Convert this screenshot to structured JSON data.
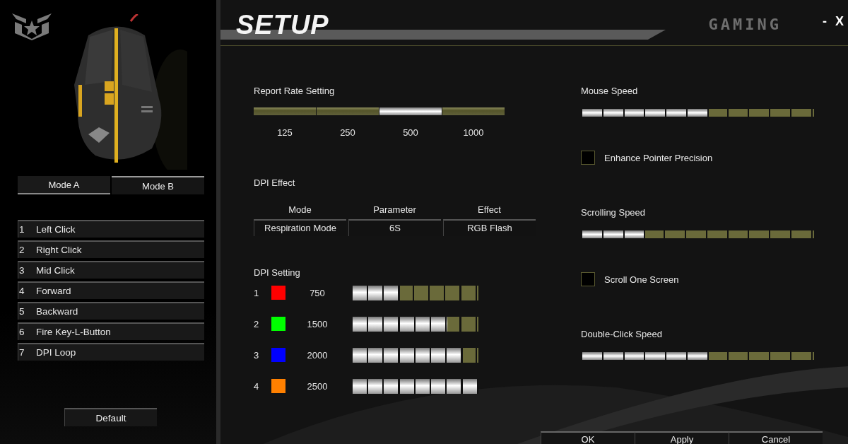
{
  "window": {
    "title": "SETUP",
    "brand": "GAMING",
    "minimize": "-",
    "close": "X"
  },
  "modes": [
    {
      "label": "Mode A",
      "selected": false
    },
    {
      "label": "Mode B",
      "selected": true
    }
  ],
  "button_assignments": [
    {
      "number": "1",
      "action": "Left Click"
    },
    {
      "number": "2",
      "action": "Right Click"
    },
    {
      "number": "3",
      "action": "Mid Click"
    },
    {
      "number": "4",
      "action": "Forward"
    },
    {
      "number": "5",
      "action": "Backward"
    },
    {
      "number": "6",
      "action": "Fire Key-L-Button"
    },
    {
      "number": "7",
      "action": "DPI Loop"
    }
  ],
  "default_button": "Default",
  "report_rate": {
    "title": "Report Rate Setting",
    "options": [
      {
        "label": "125",
        "selected": false
      },
      {
        "label": "250",
        "selected": false
      },
      {
        "label": "500",
        "selected": true
      },
      {
        "label": "1000",
        "selected": false
      }
    ]
  },
  "dpi_effect": {
    "title": "DPI Effect",
    "columns": [
      "Mode",
      "Parameter",
      "Effect"
    ],
    "values": [
      "Respiration Mode",
      "6S",
      "RGB Flash"
    ]
  },
  "dpi_setting": {
    "title": "DPI Setting",
    "rows": [
      {
        "number": "1",
        "color": "#ff0000",
        "value": "750",
        "level": 0.375
      },
      {
        "number": "2",
        "color": "#00ff00",
        "value": "1500",
        "level": 0.75
      },
      {
        "number": "3",
        "color": "#0000ff",
        "value": "2000",
        "level": 0.875
      },
      {
        "number": "4",
        "color": "#ff8000",
        "value": "2500",
        "level": 1
      }
    ]
  },
  "settings": [
    {
      "kind": "slider",
      "label": "Mouse Speed",
      "level": 0.5455
    },
    {
      "kind": "checkbox",
      "label": "Enhance Pointer Precision",
      "checked": false
    },
    {
      "kind": "slider",
      "label": "Scrolling Speed",
      "level": 0.2727
    },
    {
      "kind": "checkbox",
      "label": "Scroll One Screen",
      "checked": false
    },
    {
      "kind": "slider",
      "label": "Double-Click Speed",
      "level": 0.5455
    }
  ],
  "footer_buttons": [
    "OK",
    "Apply",
    "Cancel"
  ]
}
